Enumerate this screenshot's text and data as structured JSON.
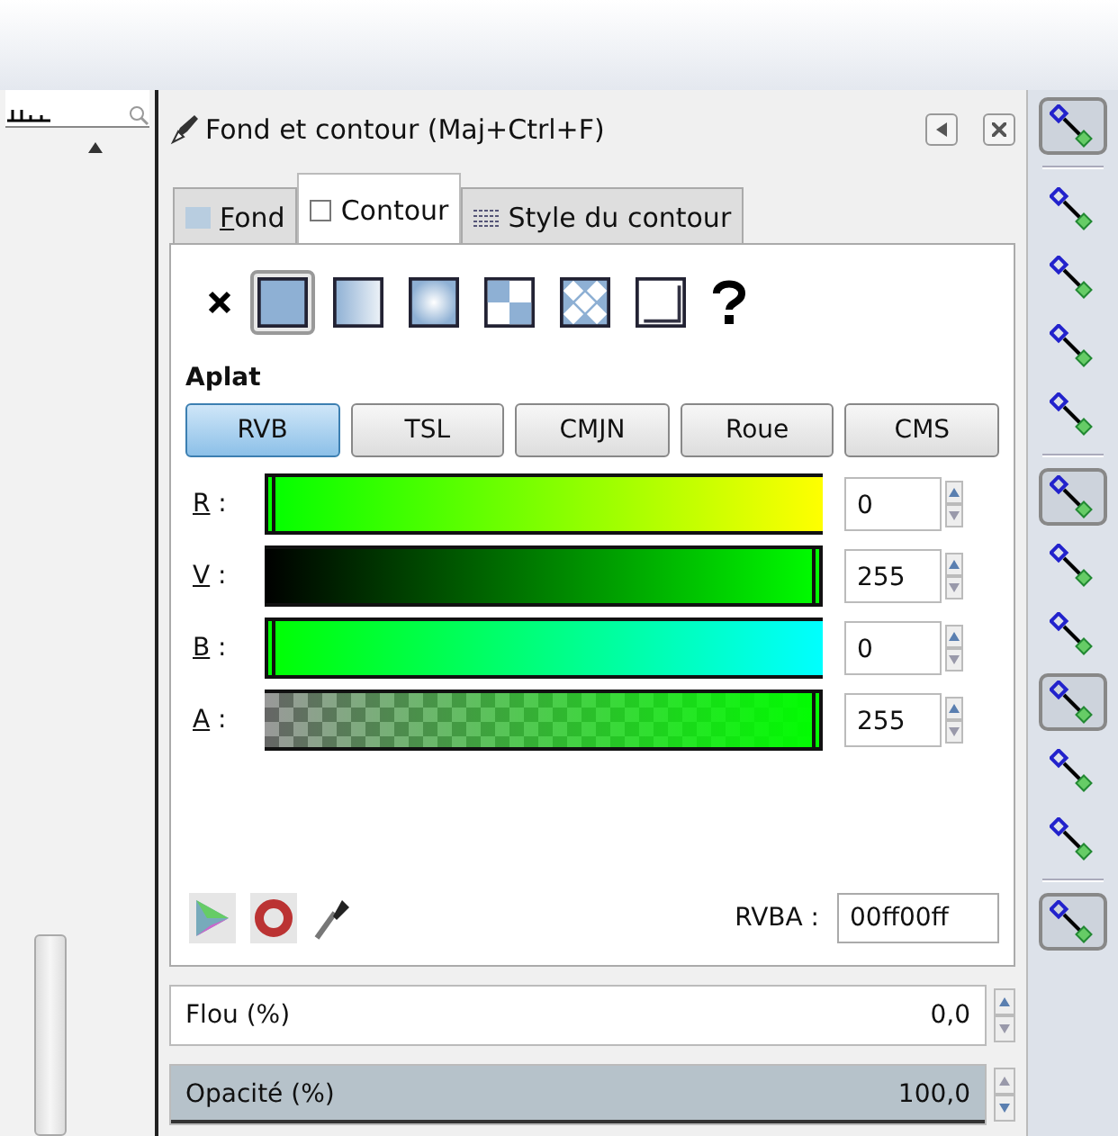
{
  "dialog": {
    "title": "Fond et contour (Maj+Ctrl+F)"
  },
  "tabs": [
    {
      "label": "Fond",
      "selected": false,
      "kind": "fill"
    },
    {
      "label": "Contour",
      "selected": true,
      "kind": "stroke"
    },
    {
      "label": "Style du contour",
      "selected": false,
      "kind": "style"
    }
  ],
  "paint_types": [
    {
      "kind": "none",
      "selected": false
    },
    {
      "kind": "flat",
      "selected": true
    },
    {
      "kind": "linear",
      "selected": false
    },
    {
      "kind": "radial",
      "selected": false
    },
    {
      "kind": "mesh",
      "selected": false
    },
    {
      "kind": "pattern",
      "selected": false
    },
    {
      "kind": "swatch",
      "selected": false
    },
    {
      "kind": "unset",
      "selected": false
    }
  ],
  "section_title": "Aplat",
  "modes": [
    {
      "label": "RVB",
      "selected": true
    },
    {
      "label": "TSL",
      "selected": false
    },
    {
      "label": "CMJN",
      "selected": false
    },
    {
      "label": "Roue",
      "selected": false
    },
    {
      "label": "CMS",
      "selected": false
    }
  ],
  "channels": [
    {
      "label": "R :",
      "value": "0",
      "level": 0,
      "kind": "red"
    },
    {
      "label": "V :",
      "value": "255",
      "level": 1,
      "kind": "green"
    },
    {
      "label": "B :",
      "value": "0",
      "level": 0,
      "kind": "blue"
    },
    {
      "label": "A :",
      "value": "255",
      "level": 1,
      "kind": "alpha"
    }
  ],
  "rgba": {
    "label": "RVBA :",
    "value": "00ff00ff"
  },
  "blur": {
    "label": "Flou (%)",
    "value": "0,0"
  },
  "opacity": {
    "label": "Opacité (%)",
    "value": "100,0",
    "level": 1
  },
  "snap_toolbar": [
    {
      "kind": "button",
      "on": true
    },
    {
      "kind": "separator"
    },
    {
      "kind": "button",
      "on": false
    },
    {
      "kind": "button",
      "on": false
    },
    {
      "kind": "button",
      "on": false
    },
    {
      "kind": "button",
      "on": false
    },
    {
      "kind": "separator"
    },
    {
      "kind": "button",
      "on": true
    },
    {
      "kind": "button",
      "on": false
    },
    {
      "kind": "button",
      "on": false
    },
    {
      "kind": "button",
      "on": true
    },
    {
      "kind": "button",
      "on": false
    },
    {
      "kind": "button",
      "on": false
    },
    {
      "kind": "separator"
    },
    {
      "kind": "button",
      "on": true
    }
  ]
}
